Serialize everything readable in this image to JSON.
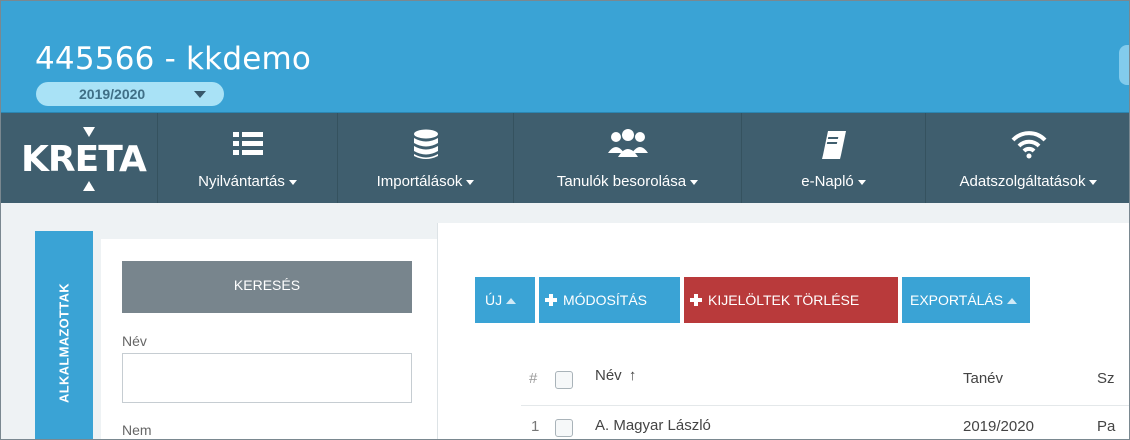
{
  "header": {
    "title": "445566 - kkdemo",
    "school_year": "2019/2020"
  },
  "brand": {
    "logo_text": "KRETA"
  },
  "nav": {
    "items": [
      {
        "label": "Nyilvántartás",
        "icon": "list-icon"
      },
      {
        "label": "Importálások",
        "icon": "database-icon"
      },
      {
        "label": "Tanulók besorolása",
        "icon": "users-icon"
      },
      {
        "label": "e-Napló",
        "icon": "book-icon"
      },
      {
        "label": "Adatszolgáltatások",
        "icon": "wifi-icon"
      }
    ]
  },
  "sidebar": {
    "tab_label": "ALKALMAZOTTAK"
  },
  "search": {
    "button_label": "KERESÉS",
    "name_label": "Név",
    "name_value": "",
    "gender_label": "Nem"
  },
  "toolbar": {
    "new_label": "ÚJ",
    "modify_label": "MÓDOSÍTÁS",
    "delete_label": "KIJELÖLTEK TÖRLÉSE",
    "export_label": "EXPORTÁLÁS"
  },
  "table": {
    "columns": {
      "index": "#",
      "name": "Név",
      "name_sort": "↑",
      "year": "Tanév",
      "col4": "Sz"
    },
    "rows": [
      {
        "index": "1",
        "name": "A. Magyar László",
        "year": "2019/2020",
        "col4": "Pa"
      }
    ]
  },
  "colors": {
    "header_bg": "#3aa3d5",
    "nav_bg": "#3f5e6e",
    "delete_red": "#b93a3b",
    "search_gray": "#78858d"
  }
}
